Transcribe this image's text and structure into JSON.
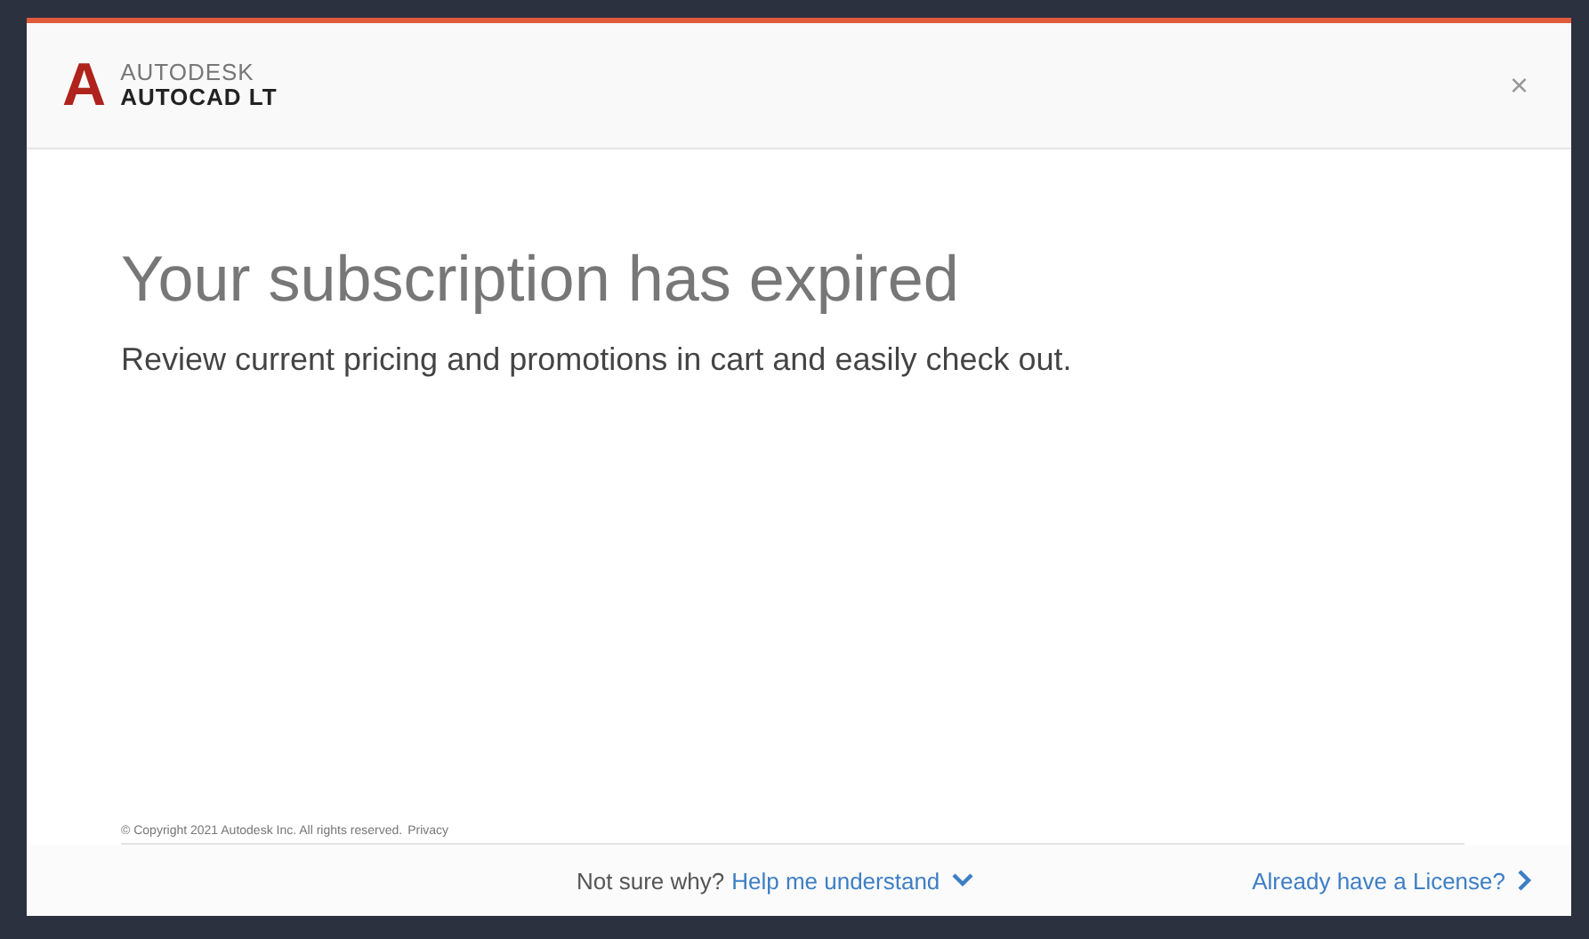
{
  "dialog": {
    "brand": {
      "company": "AUTODESK",
      "product": "AUTOCAD LT",
      "mark": "A"
    },
    "close": "×"
  },
  "title": "Your subscription has expired",
  "subtitle": "Review current pricing and promotions in cart and easily check out.",
  "copyright": "© Copyright 2021 Autodesk Inc. All rights reserved.",
  "privacy": "Privacy",
  "footer": {
    "question": "Not sure why?",
    "help_link": "Help me understand",
    "license_link": "Already have a License?"
  }
}
